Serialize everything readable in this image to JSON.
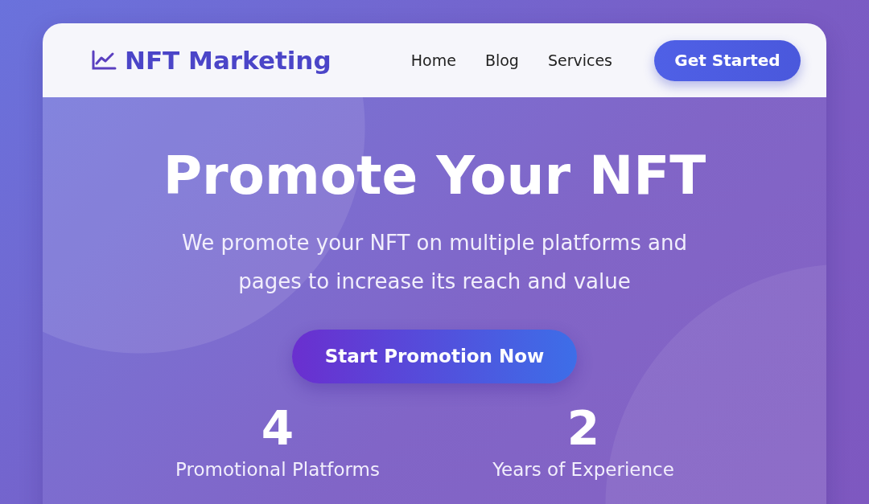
{
  "header": {
    "logo": "NFT Marketing",
    "nav": [
      {
        "label": "Home"
      },
      {
        "label": "Blog"
      },
      {
        "label": "Services"
      }
    ],
    "cta": "Get Started"
  },
  "hero": {
    "title": "Promote Your NFT",
    "subtitle": "We promote your NFT on multiple platforms and pages to increase its reach and value",
    "button": "Start Promotion Now"
  },
  "stats": [
    {
      "value": "4",
      "label": "Promotional Platforms"
    },
    {
      "value": "2",
      "label": "Years of Experience"
    }
  ]
}
